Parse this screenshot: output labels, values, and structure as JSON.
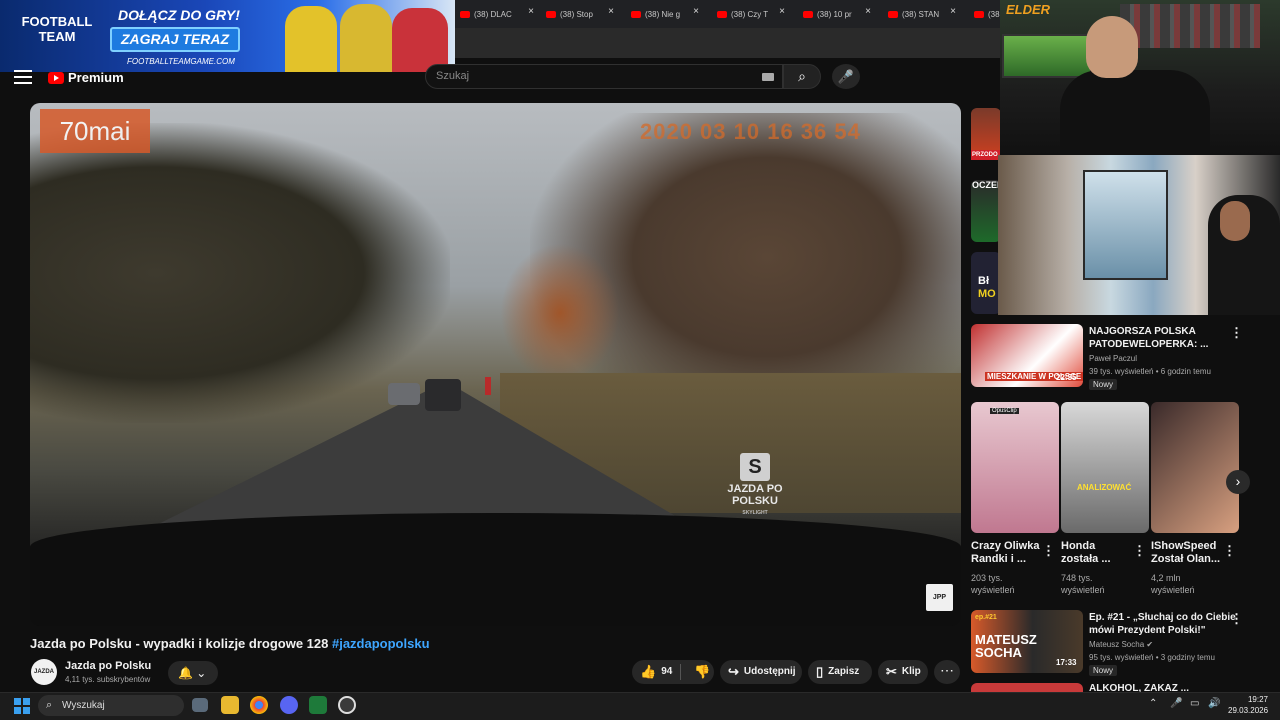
{
  "browser": {
    "tabs": [
      {
        "label": "(38) DLAC"
      },
      {
        "label": "(38) Stop"
      },
      {
        "label": "(38) Nie g"
      },
      {
        "label": "(38) Czy T"
      },
      {
        "label": "(38) 10 pr"
      },
      {
        "label": "(38) STAN"
      },
      {
        "label": "(38"
      }
    ],
    "close_glyph": "×"
  },
  "ad": {
    "logo_text": "FOOTBALL TEAM",
    "headline": "DOŁĄCZ DO GRY!",
    "cta": "ZAGRAJ TERAZ",
    "url": "FOOTBALLTEAMGAME.COM"
  },
  "youtube": {
    "logo_text": "Premium",
    "search_placeholder": "Szukaj",
    "search_icon": "⌕",
    "mic_icon": "🎤"
  },
  "video": {
    "brand": "70mai",
    "timestamp": "2020 03 10 16 36 54",
    "watermark_line1": "JAZDA PO",
    "watermark_line2": "POLSKU",
    "watermark_small": "SKYLIGHT",
    "corner_mark": "JPP",
    "title": "Jazda po Polsku - wypadki i kolizje drogowe 128 ",
    "hashtag": "#jazdapopolsku",
    "channel_name": "Jazda po Polsku",
    "channel_avatar_text": "JAZDA PO POLSKU",
    "subscribers": "4,11 tys. subskrybentów",
    "likes": "94",
    "share": "Udostępnij",
    "save": "Zapisz",
    "clip": "Klip",
    "more": "⋯"
  },
  "stream": {
    "overlay_name": "ELDER"
  },
  "sidebar": {
    "partial_labels": [
      "PRZODO",
      "OCZEK",
      "Bł",
      "MO"
    ],
    "items": [
      {
        "title_line1": "NAJGORSZA POLSKA",
        "title_line2": "PATODEWELOPERKA: ...",
        "channel": "Paweł Paczul",
        "meta": "39 tys. wyświetleń • 6 godzin temu",
        "badge": "Nowy",
        "thumb_caption": "MIESZKANIE W POLSCE",
        "duration": "22:35"
      },
      {
        "title_line1": "Ep. #21 - „Słuchaj co do Ciebie",
        "title_line2": "mówi Prezydent Polski!\"",
        "channel": "Mateusz Socha",
        "meta": "95 tys. wyświetleń • 3 godziny temu",
        "badge": "Nowy",
        "thumb_top": "ep.#21",
        "thumb_name": "MATEUSZ SOCHA",
        "duration": "17:33"
      },
      {
        "title_line1": "ALKOHOL, ZAKAZ ..."
      }
    ],
    "shorts": [
      {
        "title_line1": "Crazy Oliwka",
        "title_line2": "Randki i ...",
        "views_line1": "203 tys.",
        "views_line2": "wyświetleń",
        "thumb_label": "OpusClip"
      },
      {
        "title_line1": "Honda",
        "title_line2": "została ...",
        "views_line1": "748 tys.",
        "views_line2": "wyświetleń",
        "thumb_label": "ANALIZOWAĆ"
      },
      {
        "title_line1": "IShowSpeed",
        "title_line2": "Został Olan...",
        "views_line1": "4,2 mln",
        "views_line2": "wyświetleń",
        "thumb_label": ""
      }
    ]
  },
  "taskbar": {
    "search_label": "Wyszukaj",
    "time": "19:27",
    "date": "29.03.2026"
  }
}
